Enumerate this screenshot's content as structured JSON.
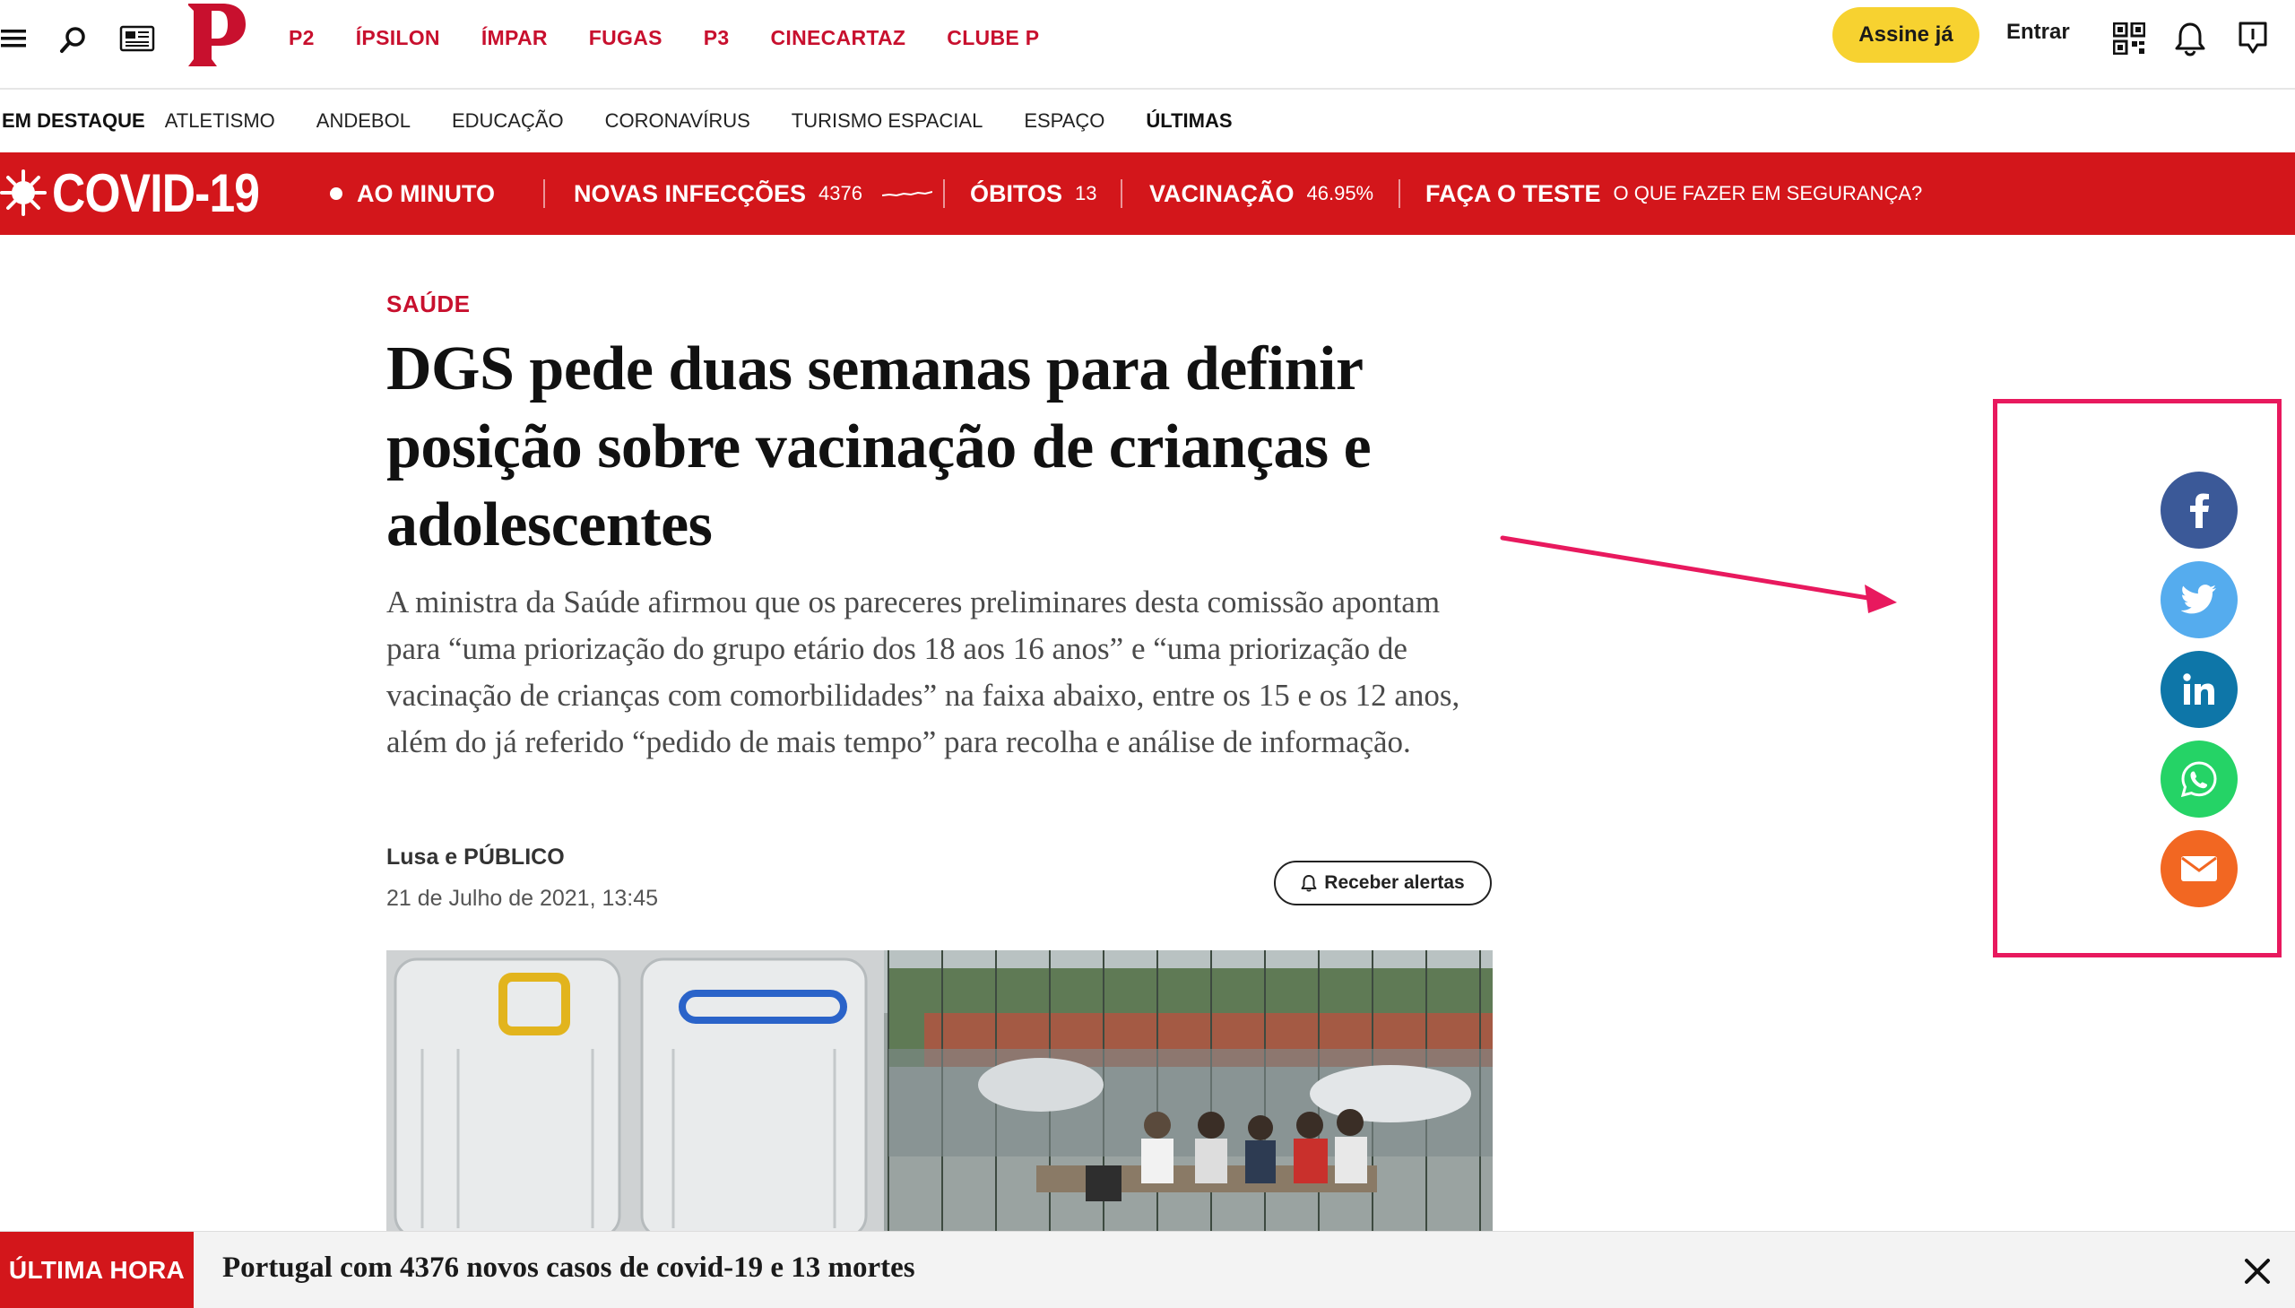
{
  "header": {
    "main_nav": [
      "P2",
      "ÍPSILON",
      "ÍMPAR",
      "FUGAS",
      "P3",
      "CINECARTAZ",
      "CLUBE P"
    ],
    "subscribe_label": "Assine já",
    "login_label": "Entrar",
    "logo_letter": "P",
    "brand_color": "#c8102e"
  },
  "secondary_nav": {
    "lead": "EM DESTAQUE",
    "items": [
      "ATLETISMO",
      "ANDEBOL",
      "EDUCAÇÃO",
      "CORONAVÍRUS",
      "TURISMO ESPACIAL",
      "ESPAÇO",
      "ÚLTIMAS"
    ]
  },
  "covid_bar": {
    "brand": "COVID-19",
    "live": "AO MINUTO",
    "infections_label": "NOVAS INFECÇÕES",
    "infections_value": "4376",
    "deaths_label": "ÓBITOS",
    "deaths_value": "13",
    "vaccination_label": "VACINAÇÃO",
    "vaccination_value": "46.95%",
    "test_label": "FAÇA O TESTE",
    "test_sub": "O QUE FAZER EM SEGURANÇA?",
    "bar_color": "#d3161b"
  },
  "article": {
    "section": "SAÚDE",
    "headline": "DGS pede duas semanas para definir posição sobre vacinação de crianças e adolescentes",
    "lede": "A ministra da Saúde afirmou que os pareceres preliminares desta comissão apontam para “uma priorização do grupo etário dos 18 aos 16 anos” e “uma priorização de vacinação de crianças com comorbilidades” na faixa abaixo, entre os 15 e os 12 anos, além do já referido “pedido de mais tempo” para recolha e análise de informação.",
    "author": "Lusa e PÚBLICO",
    "date": "21 de Julho de 2021, 13:45",
    "alerts_label": "Receber alertas"
  },
  "share": {
    "buttons": [
      {
        "name": "facebook",
        "icon": "facebook-icon",
        "color": "#3b5998"
      },
      {
        "name": "twitter",
        "icon": "twitter-icon",
        "color": "#55acee"
      },
      {
        "name": "linkedin",
        "icon": "linkedin-icon",
        "color": "#0e76a8"
      },
      {
        "name": "whatsapp",
        "icon": "whatsapp-icon",
        "color": "#25d366"
      },
      {
        "name": "email",
        "icon": "email-icon",
        "color": "#f26722"
      }
    ],
    "highlight_color": "#e8195e"
  },
  "breaking": {
    "tag": "ÚLTIMA HORA",
    "text": "Portugal com 4376 novos casos de covid-19 e 13 mortes"
  }
}
